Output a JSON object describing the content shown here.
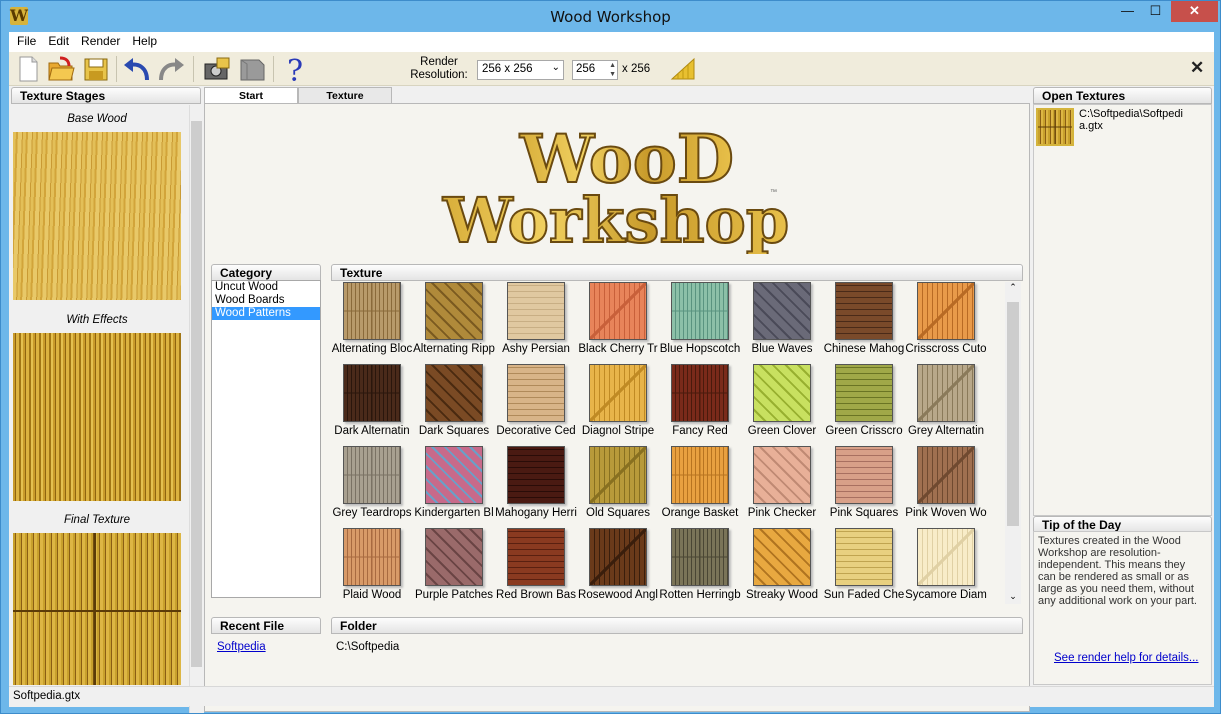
{
  "window": {
    "title": "Wood Workshop",
    "icon_letter": "W",
    "minimize": "—",
    "maximize": "☐",
    "close": "✕"
  },
  "menu": {
    "items": [
      "File",
      "Edit",
      "Render",
      "Help"
    ]
  },
  "toolbar": {
    "render_label": "Render\nResolution:",
    "resolution_value": "256 x 256",
    "width_value": "256",
    "height_suffix": "x 256",
    "close_glyph": "✕",
    "icons": [
      "new-icon",
      "open-icon",
      "save-icon",
      "undo-icon",
      "redo-icon",
      "camera-icon",
      "texture-icon",
      "help-icon",
      "render-icon"
    ]
  },
  "left_panel": {
    "header": "Texture Stages",
    "stages": [
      "Base Wood",
      "With Effects",
      "Final Texture"
    ]
  },
  "tabs": [
    "Start",
    "Texture"
  ],
  "logo": {
    "line1": "WooD",
    "line2": "Workshop",
    "tm": "™"
  },
  "category": {
    "header": "Category",
    "items": [
      "Uncut Wood",
      "Wood Boards",
      "Wood Patterns"
    ],
    "selected": "Wood Patterns"
  },
  "texture": {
    "header": "Texture",
    "items": [
      {
        "name": "Alternating Bloc",
        "c1": "#b89a6a",
        "c2": "#8a6a3a"
      },
      {
        "name": "Alternating Ripp",
        "c1": "#b08a3a",
        "c2": "#7a5a20"
      },
      {
        "name": "Ashy Persian",
        "c1": "#e0c8a0",
        "c2": "#c8ae84"
      },
      {
        "name": "Black Cherry Tr",
        "c1": "#e8845a",
        "c2": "#c8603a"
      },
      {
        "name": "Blue Hopscotch",
        "c1": "#8cc0a8",
        "c2": "#5a9480"
      },
      {
        "name": "Blue Waves",
        "c1": "#6a6a78",
        "c2": "#4a4a58"
      },
      {
        "name": "Chinese Mahog",
        "c1": "#7a4a2a",
        "c2": "#4a2a18"
      },
      {
        "name": "Crisscross Cuto",
        "c1": "#e89a4a",
        "c2": "#b86a24"
      },
      {
        "name": "Dark Alternatin",
        "c1": "#4a2a1a",
        "c2": "#2a160c"
      },
      {
        "name": "Dark Squares",
        "c1": "#7a4a24",
        "c2": "#4a2a10"
      },
      {
        "name": "Decorative Ced",
        "c1": "#d8b488",
        "c2": "#b08a5a"
      },
      {
        "name": "Diagnol Stripe",
        "c1": "#e8b44a",
        "c2": "#c08a24"
      },
      {
        "name": "Fancy Red",
        "c1": "#7a2a1a",
        "c2": "#4a1a0c"
      },
      {
        "name": "Green Clover",
        "c1": "#c8e060",
        "c2": "#98b030"
      },
      {
        "name": "Green Crisscro",
        "c1": "#a0a848",
        "c2": "#6a7424"
      },
      {
        "name": "Grey Alternatin",
        "c1": "#b8a88a",
        "c2": "#8a7a5a"
      },
      {
        "name": "Grey Teardrops",
        "c1": "#a8a090",
        "c2": "#7a7264"
      },
      {
        "name": "Kindergarten Bl",
        "c1": "#c86a8a",
        "c2": "#6aa0c8"
      },
      {
        "name": "Mahogany Herri",
        "c1": "#4a1a12",
        "c2": "#2a0c08"
      },
      {
        "name": "Old Squares",
        "c1": "#b89a3a",
        "c2": "#887020"
      },
      {
        "name": "Orange Basket",
        "c1": "#e8a040",
        "c2": "#b87420"
      },
      {
        "name": "Pink Checker",
        "c1": "#e8b098",
        "c2": "#c08a74"
      },
      {
        "name": "Pink Squares",
        "c1": "#d8a088",
        "c2": "#a87060"
      },
      {
        "name": "Pink Woven Wo",
        "c1": "#a07050",
        "c2": "#704a30"
      },
      {
        "name": "Plaid Wood",
        "c1": "#d89a68",
        "c2": "#a86a40"
      },
      {
        "name": "Purple Patches",
        "c1": "#9a6a6a",
        "c2": "#6a4444"
      },
      {
        "name": "Red Brown Bas",
        "c1": "#8a3a20",
        "c2": "#5a2010"
      },
      {
        "name": "Rosewood Angl",
        "c1": "#6a3a1a",
        "c2": "#3a1e0c"
      },
      {
        "name": "Rotten Herringb",
        "c1": "#7a7458",
        "c2": "#4a4634"
      },
      {
        "name": "Streaky Wood",
        "c1": "#e8a840",
        "c2": "#b07420"
      },
      {
        "name": "Sun Faded Che",
        "c1": "#e8d080",
        "c2": "#c0a450"
      },
      {
        "name": "Sycamore Diam",
        "c1": "#f8ecc8",
        "c2": "#e0d0a4"
      }
    ]
  },
  "recent": {
    "header": "Recent File",
    "file": "Softpedia"
  },
  "folder": {
    "header": "Folder",
    "path": "C:\\Softpedia"
  },
  "open_textures": {
    "header": "Open Textures",
    "file": "C:\\Softpedia\\Softpedia.gtx"
  },
  "tip": {
    "header": "Tip of the Day",
    "text": "Textures created in the Wood Workshop are resolution-independent.  This means they can be rendered as small or as large as you need them, without any additional work on your part.",
    "link": "See render help for details..."
  },
  "status": {
    "text": "Softpedia.gtx"
  },
  "colors": {
    "titlebar": "#6db7ea",
    "selection": "#3399ff",
    "link": "#0000cc",
    "close": "#c7504b"
  }
}
